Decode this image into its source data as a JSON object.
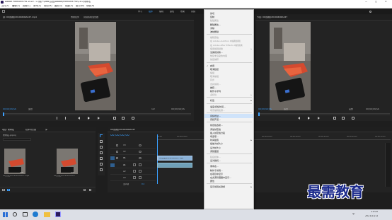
{
  "window": {
    "title": "Adobe Premiere Pro 2020 - C:\\用户\\Ideo\\文档\\Adobe\\Premiere Pro\\14.0\\未命名",
    "menu": [
      "文件(F)",
      "编辑(E)",
      "剪辑(C)",
      "序列(S)",
      "标记(M)",
      "图形(G)",
      "视图(V)",
      "窗口(W)",
      "帮助(H)"
    ],
    "controls": [
      "—",
      "□",
      "✕"
    ]
  },
  "workspace_tabs": [
    "学习",
    "组件",
    "编辑",
    "颜色",
    "效果",
    "音频",
    "图形",
    "库"
  ],
  "source_monitor": {
    "tab": "源: 00(剪辑)20190406A227.mp4",
    "tab2": "效果控件",
    "tab3": "音频剪辑混合器",
    "tab4": "元数据",
    "timecode_left": "00;00;00;00",
    "fit": "适合",
    "ratio": "1/2",
    "timecode_right": "00;00;00;00"
  },
  "program_monitor": {
    "tab": "节目: 00(剪辑)20190406A227",
    "timecode_left": "00;00;00;00",
    "fit": "适合",
    "ratio": "完整",
    "timecode_right": "00;00;00;00"
  },
  "project_panel": {
    "tabs": [
      "项目: 未命名",
      "媒体浏览器",
      "库",
      "信息"
    ],
    "project_name": "未命名.prproj",
    "search_placeholder": "",
    "items": [
      {
        "name": "00(剪辑)20190406A227.mp4",
        "duration": "2;07"
      },
      {
        "name": "00(剪辑)20190406A227",
        "duration": "2;07"
      }
    ]
  },
  "timeline": {
    "tab": "00(剪辑)20190406A227",
    "timecode": "00;00;00;00",
    "ruler": [
      "00;00",
      "00;00;04;00",
      "00;00;08;00",
      "00;00;12;00",
      "00;00;16;00",
      "00;00;20;00",
      "00;00;24;00",
      "00;00;28;00",
      "00;00;32;00"
    ],
    "tracks": [
      "V3",
      "V2",
      "V1",
      "A1",
      "A2",
      "A3"
    ],
    "master": "主声道",
    "master_value": "0.0",
    "clip_v": "00(剪辑)20190406A227.mp4",
    "clip_a": ""
  },
  "context_menu": {
    "items": [
      {
        "label": "剪切",
        "state": "normal"
      },
      {
        "label": "复制",
        "state": "normal"
      },
      {
        "label": "粘贴属性",
        "state": "disabled"
      },
      {
        "label": "删除属性...",
        "state": "normal"
      },
      {
        "label": "清除",
        "state": "normal"
      },
      {
        "label": "波纹删除",
        "state": "normal"
      },
      {
        "sep": true
      },
      {
        "label": "编辑原始",
        "state": "disabled"
      },
      {
        "label": "在 Adobe Audition 中编辑剪辑",
        "state": "disabled"
      },
      {
        "label": "在 Adobe After Effects 中的替换",
        "state": "disabled"
      },
      {
        "label": "使用剪辑替换",
        "state": "disabled",
        "arrow": true
      },
      {
        "label": "渲染和替换...",
        "state": "normal"
      },
      {
        "label": "恢复未渲染的内容",
        "state": "disabled"
      },
      {
        "label": "恢复捕获",
        "state": "disabled"
      },
      {
        "sep": true
      },
      {
        "label": "启用",
        "state": "normal",
        "check": true
      },
      {
        "label": "取消链接",
        "state": "normal"
      },
      {
        "label": "编组",
        "state": "disabled"
      },
      {
        "label": "取消编组",
        "state": "disabled"
      },
      {
        "label": "同步",
        "state": "disabled"
      },
      {
        "label": "合并剪辑...",
        "state": "disabled"
      },
      {
        "label": "嵌套...",
        "state": "normal"
      },
      {
        "label": "制作子序列",
        "state": "normal"
      },
      {
        "label": "多机位",
        "state": "disabled",
        "arrow": true
      },
      {
        "sep": true
      },
      {
        "label": "标签",
        "state": "normal",
        "arrow": true
      },
      {
        "sep": true
      },
      {
        "label": "速度/持续时间...",
        "state": "normal"
      },
      {
        "label": "场景编辑检测...",
        "state": "disabled"
      },
      {
        "sep": true
      },
      {
        "label": "音频增益...",
        "state": "highlight"
      },
      {
        "label": "音频声道...",
        "state": "normal"
      },
      {
        "sep": true
      },
      {
        "label": "帧定格选项...",
        "state": "normal"
      },
      {
        "label": "添加帧定格",
        "state": "normal"
      },
      {
        "label": "插入帧定格分段",
        "state": "normal"
      },
      {
        "label": "场选项...",
        "state": "normal"
      },
      {
        "label": "时间插值",
        "state": "normal",
        "arrow": true
      },
      {
        "label": "缩放为帧大小",
        "state": "normal"
      },
      {
        "label": "设为帧大小",
        "state": "normal"
      },
      {
        "label": "调整图层",
        "state": "normal"
      },
      {
        "sep": true
      },
      {
        "label": "链接媒体...",
        "state": "disabled"
      },
      {
        "label": "设为脱机...",
        "state": "normal"
      },
      {
        "sep": true
      },
      {
        "label": "重命名...",
        "state": "normal"
      },
      {
        "label": "制作子剪辑...",
        "state": "normal"
      },
      {
        "label": "在项目中显示",
        "state": "normal"
      },
      {
        "label": "在资源管理器中显示...",
        "state": "normal"
      },
      {
        "label": "属性",
        "state": "normal"
      },
      {
        "sep": true
      },
      {
        "label": "显示剪辑关键帧",
        "state": "normal",
        "arrow": true
      }
    ]
  },
  "taskbar": {
    "time": "11:03",
    "date": "2021/11/12",
    "lang": "中"
  },
  "watermark": "最需教育",
  "colors": {
    "accent": "#3aa0ff",
    "clip_video": "#8bb2d8",
    "menu_bg": "#f2f2f2",
    "menu_highlight": "#cfe3fa",
    "watermark": "#1b2a8c"
  }
}
